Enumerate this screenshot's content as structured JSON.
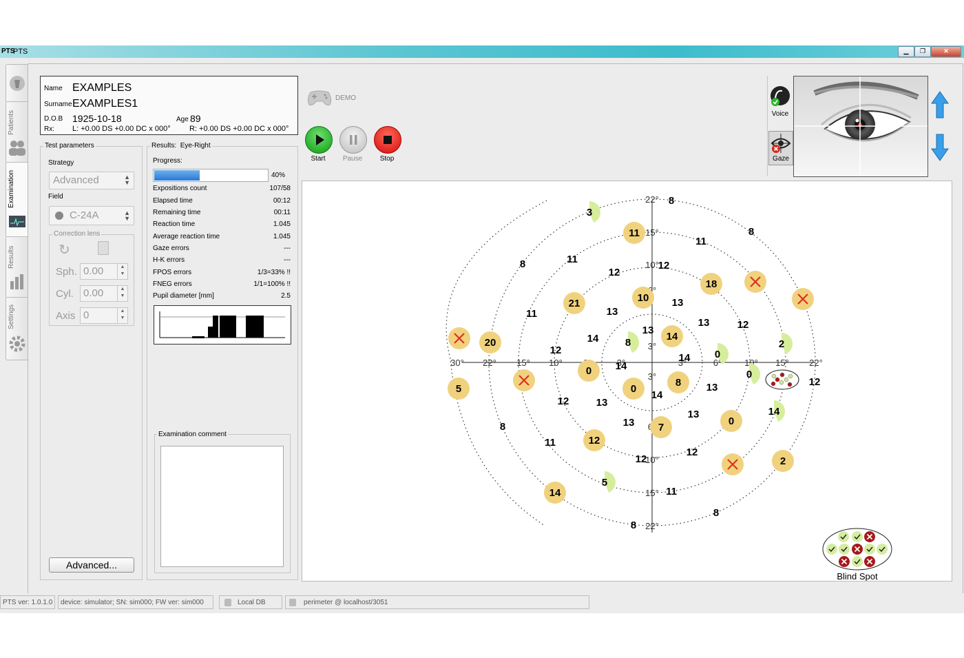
{
  "window": {
    "title": "PTS",
    "icon": "PTS"
  },
  "tabs": [
    {
      "label": ""
    },
    {
      "label": "Patients"
    },
    {
      "label": "Examination"
    },
    {
      "label": "Results"
    },
    {
      "label": "Settings"
    }
  ],
  "patient": {
    "name_label": "Name",
    "name": "EXAMPLES",
    "surname_label": "Surname",
    "surname": "EXAMPLES1",
    "dob_label": "D.O.B",
    "dob": "1925-10-18",
    "age_label": "Age",
    "age": "89",
    "rx_label": "Rx:",
    "rx_left": "L: +0.00 DS +0.00 DC x 000°",
    "rx_right": "R: +0.00 DS +0.00 DC x 000°"
  },
  "test_params": {
    "title": "Test parameters",
    "strategy_label": "Strategy",
    "strategy": "Advanced",
    "field_label": "Field",
    "field": "C-24A",
    "correction_lens": "Correction lens",
    "sph_label": "Sph.",
    "sph": "0.00",
    "cyl_label": "Cyl.",
    "cyl": "0.00",
    "axis_label": "Axis",
    "axis": "0",
    "advanced_button": "Advanced..."
  },
  "results": {
    "title": "Results:",
    "eye": "Eye-Right",
    "progress_label": "Progress:",
    "progress_text": "40%",
    "progress_value": 0.4,
    "stats": [
      {
        "label": "Expositions count",
        "value": "107/58"
      },
      {
        "label": "Elapsed time",
        "value": "00:12"
      },
      {
        "label": "Remaining time",
        "value": "00:11"
      },
      {
        "label": "Reaction time",
        "value": "1.045"
      },
      {
        "label": "Average reaction time",
        "value": "1.045"
      },
      {
        "label": "Gaze errors",
        "value": "---"
      },
      {
        "label": "H-K errors",
        "value": "---"
      },
      {
        "label": "FPOS errors",
        "value": "1/3=33% !!"
      },
      {
        "label": "FNEG errors",
        "value": "1/1=100% !!"
      },
      {
        "label": "Pupil diameter [mm]",
        "value": "2.5"
      }
    ],
    "comment_label": "Examination comment",
    "comment": ""
  },
  "controls": {
    "demo_label": "DEMO",
    "start": "Start",
    "pause": "Pause",
    "stop": "Stop",
    "voice": "Voice",
    "gaze": "Gaze"
  },
  "field_plot": {
    "axis_ticks_h": [
      "30°",
      "22°",
      "15°",
      "10°",
      "6°",
      "3°",
      "3°",
      "6°",
      "10°",
      "15°",
      "22°"
    ],
    "axis_ticks_v": [
      "22°",
      "15°",
      "10°",
      "6°",
      "3°",
      "3°",
      "6°",
      "10°",
      "15°",
      "22°"
    ],
    "points": [
      {
        "v": "3",
        "style": "partial"
      },
      {
        "v": "8",
        "style": "plain"
      },
      {
        "v": "11",
        "style": "seen"
      },
      {
        "v": "11",
        "style": "plain"
      },
      {
        "v": "8",
        "style": "plain"
      },
      {
        "v": "8",
        "style": "plain"
      },
      {
        "v": "11",
        "style": "plain"
      },
      {
        "v": "12",
        "style": "plain"
      },
      {
        "v": "12",
        "style": "plain"
      },
      {
        "v": "18",
        "style": "seen"
      },
      {
        "v": "",
        "style": "miss"
      },
      {
        "v": "",
        "style": "miss"
      },
      {
        "v": "21",
        "style": "seen"
      },
      {
        "v": "10",
        "style": "seen"
      },
      {
        "v": "13",
        "style": "plain"
      },
      {
        "v": "13",
        "style": "plain"
      },
      {
        "v": "11",
        "style": "plain"
      },
      {
        "v": "13",
        "style": "plain"
      },
      {
        "v": "12",
        "style": "plain"
      },
      {
        "v": "14",
        "style": "plain"
      },
      {
        "v": "14",
        "style": "seen"
      },
      {
        "v": "13",
        "style": "plain"
      },
      {
        "v": "8",
        "style": "partial"
      },
      {
        "v": "0",
        "style": "partial"
      },
      {
        "v": "2",
        "style": "partial"
      },
      {
        "v": "",
        "style": "miss"
      },
      {
        "v": "20",
        "style": "seen"
      },
      {
        "v": "12",
        "style": "plain"
      },
      {
        "v": "14",
        "style": "plain"
      },
      {
        "v": "14",
        "style": "plain"
      },
      {
        "v": "0",
        "style": "partial"
      },
      {
        "v": "12",
        "style": "plain"
      },
      {
        "v": "5",
        "style": "seen"
      },
      {
        "v": "0",
        "style": "seen"
      },
      {
        "v": "",
        "style": "miss"
      },
      {
        "v": "0",
        "style": "seen"
      },
      {
        "v": "8",
        "style": "seen"
      },
      {
        "v": "13",
        "style": "plain"
      },
      {
        "v": "14",
        "style": "plain"
      },
      {
        "v": "12",
        "style": "plain"
      },
      {
        "v": "13",
        "style": "plain"
      },
      {
        "v": "14",
        "style": "partial"
      },
      {
        "v": "13",
        "style": "plain"
      },
      {
        "v": "13",
        "style": "plain"
      },
      {
        "v": "0",
        "style": "seen"
      },
      {
        "v": "8",
        "style": "plain"
      },
      {
        "v": "7",
        "style": "seen"
      },
      {
        "v": "11",
        "style": "plain"
      },
      {
        "v": "12",
        "style": "seen"
      },
      {
        "v": "12",
        "style": "plain"
      },
      {
        "v": "12",
        "style": "plain"
      },
      {
        "v": "2",
        "style": "seen"
      },
      {
        "v": "",
        "style": "miss"
      },
      {
        "v": "5",
        "style": "partial"
      },
      {
        "v": "11",
        "style": "plain"
      },
      {
        "v": "14",
        "style": "seen"
      },
      {
        "v": "8",
        "style": "plain"
      },
      {
        "v": "8",
        "style": "plain"
      }
    ],
    "blind_spot_label": "Blind Spot"
  },
  "statusbar": {
    "version": "PTS ver: 1.0.1.0",
    "device": "device: simulator; SN: sim000; FW ver: sim000",
    "db": "Local DB",
    "server": "perimeter @ localhost/3051"
  },
  "colors": {
    "seen": "#f0d27e",
    "partial": "#d6ee9c",
    "miss": "#e0301e",
    "accent": "#3a86d8"
  }
}
